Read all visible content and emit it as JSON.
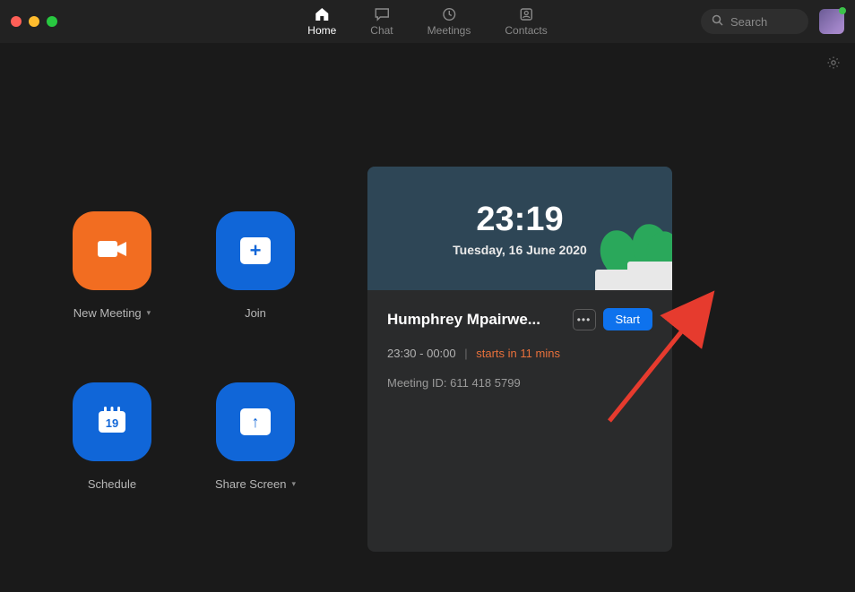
{
  "nav": {
    "tabs": [
      {
        "label": "Home",
        "active": true
      },
      {
        "label": "Chat",
        "active": false
      },
      {
        "label": "Meetings",
        "active": false
      },
      {
        "label": "Contacts",
        "active": false
      }
    ]
  },
  "search": {
    "placeholder": "Search"
  },
  "actions": {
    "new_meeting": "New Meeting",
    "join": "Join",
    "schedule": "Schedule",
    "schedule_day": "19",
    "share_screen": "Share Screen"
  },
  "clock": {
    "time": "23:19",
    "date": "Tuesday, 16 June 2020"
  },
  "meeting": {
    "title": "Humphrey Mpairwe...",
    "time_range": "23:30 - 00:00",
    "countdown": "starts in 11 mins",
    "id_label": "Meeting ID:",
    "id_value": "611 418 5799",
    "start_label": "Start"
  },
  "icons": {
    "home": "home-icon",
    "chat": "chat-icon",
    "meetings": "clock-icon",
    "contacts": "contacts-icon",
    "search": "search-icon",
    "settings": "gear-icon"
  }
}
